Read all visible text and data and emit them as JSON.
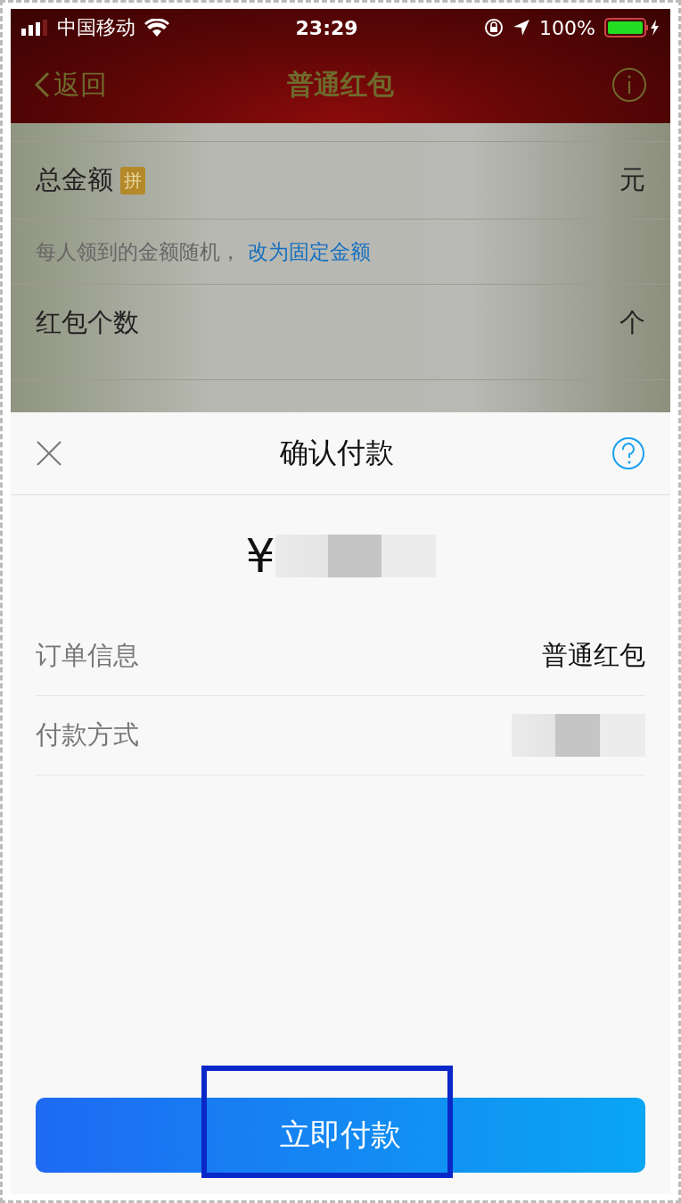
{
  "status_bar": {
    "carrier": "中国移动",
    "time": "23:29",
    "battery": "100%"
  },
  "nav": {
    "back": "返回",
    "title": "普通红包"
  },
  "form": {
    "rows": [
      {
        "kind": "field",
        "label": "总金额",
        "badge": "拼",
        "unit": "元"
      },
      {
        "kind": "note",
        "text": "每人领到的金额随机，",
        "link": "改为固定金额"
      },
      {
        "kind": "field",
        "label": "红包个数",
        "unit": "个"
      }
    ]
  },
  "dialog": {
    "title": "确认付款",
    "currency": "¥",
    "rows": [
      {
        "label": "订单信息",
        "value": "普通红包"
      },
      {
        "label": "付款方式"
      }
    ],
    "button": "立即付款"
  }
}
